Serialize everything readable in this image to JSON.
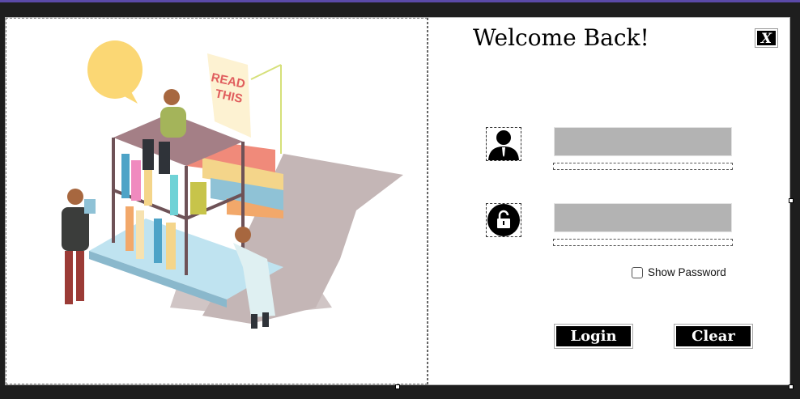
{
  "window": {
    "accent_color": "#5b4aa8",
    "background": "#1e1e1e"
  },
  "login_form": {
    "title": "Welcome Back!",
    "close_label": "X",
    "username": {
      "icon": "user-icon",
      "value": ""
    },
    "password": {
      "icon": "unlock-icon",
      "value": ""
    },
    "show_password_label": "Show Password",
    "show_password_checked": false,
    "login_label": "Login",
    "clear_label": "Clear"
  },
  "illustration": {
    "sign_text": "READ THIS",
    "icon": "reading-library-illustration"
  }
}
